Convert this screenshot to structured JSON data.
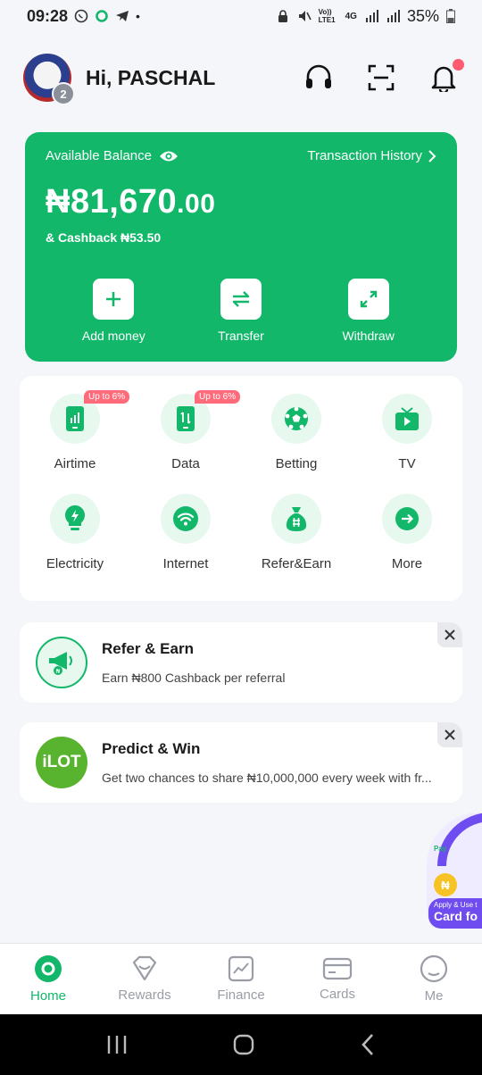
{
  "status_bar": {
    "time": "09:28",
    "network": "4G",
    "carrier": "Vo)) LTE1",
    "battery": "35%"
  },
  "header": {
    "greeting": "Hi, PASCHAL",
    "avatar_badge": "2"
  },
  "balance": {
    "label": "Available Balance",
    "history_link": "Transaction History",
    "amount_main": "₦81,670",
    "amount_decimal": ".00",
    "cashback": "& Cashback ₦53.50",
    "actions": [
      {
        "label": "Add money",
        "icon": "plus-icon"
      },
      {
        "label": "Transfer",
        "icon": "transfer-arrows-icon"
      },
      {
        "label": "Withdraw",
        "icon": "expand-arrows-icon"
      }
    ]
  },
  "services": [
    {
      "label": "Airtime",
      "icon": "phone-signal-icon",
      "promo": "Up to 6%"
    },
    {
      "label": "Data",
      "icon": "phone-data-icon",
      "promo": "Up to 6%"
    },
    {
      "label": "Betting",
      "icon": "soccer-ball-icon",
      "promo": ""
    },
    {
      "label": "TV",
      "icon": "tv-icon",
      "promo": ""
    },
    {
      "label": "Electricity",
      "icon": "lightbulb-icon",
      "promo": ""
    },
    {
      "label": "Internet",
      "icon": "wifi-icon",
      "promo": ""
    },
    {
      "label": "Refer&Earn",
      "icon": "money-bag-icon",
      "promo": ""
    },
    {
      "label": "More",
      "icon": "arrow-right-icon",
      "promo": ""
    }
  ],
  "promos": [
    {
      "title": "Refer & Earn",
      "subtitle": "Earn ₦800 Cashback per referral",
      "icon": "megaphone-icon"
    },
    {
      "title": "Predict & Win",
      "subtitle": "Get two chances to share ₦10,000,000 every week with fr...",
      "logo_text": "iLOT"
    }
  ],
  "float_ad": {
    "brand": "Pay",
    "coin": "₦",
    "small_text": "Apply & Use t",
    "big_text": "Card fo"
  },
  "bottom_nav": [
    {
      "label": "Home",
      "icon": "home-icon",
      "active": true
    },
    {
      "label": "Rewards",
      "icon": "rewards-icon",
      "active": false
    },
    {
      "label": "Finance",
      "icon": "finance-chart-icon",
      "active": false
    },
    {
      "label": "Cards",
      "icon": "card-icon",
      "active": false
    },
    {
      "label": "Me",
      "icon": "profile-icon",
      "active": false
    }
  ],
  "colors": {
    "brand_green": "#12b76a",
    "light_green": "#e7f8ef",
    "promo_red": "#ff6b7a",
    "notification": "#ff5a6e"
  }
}
